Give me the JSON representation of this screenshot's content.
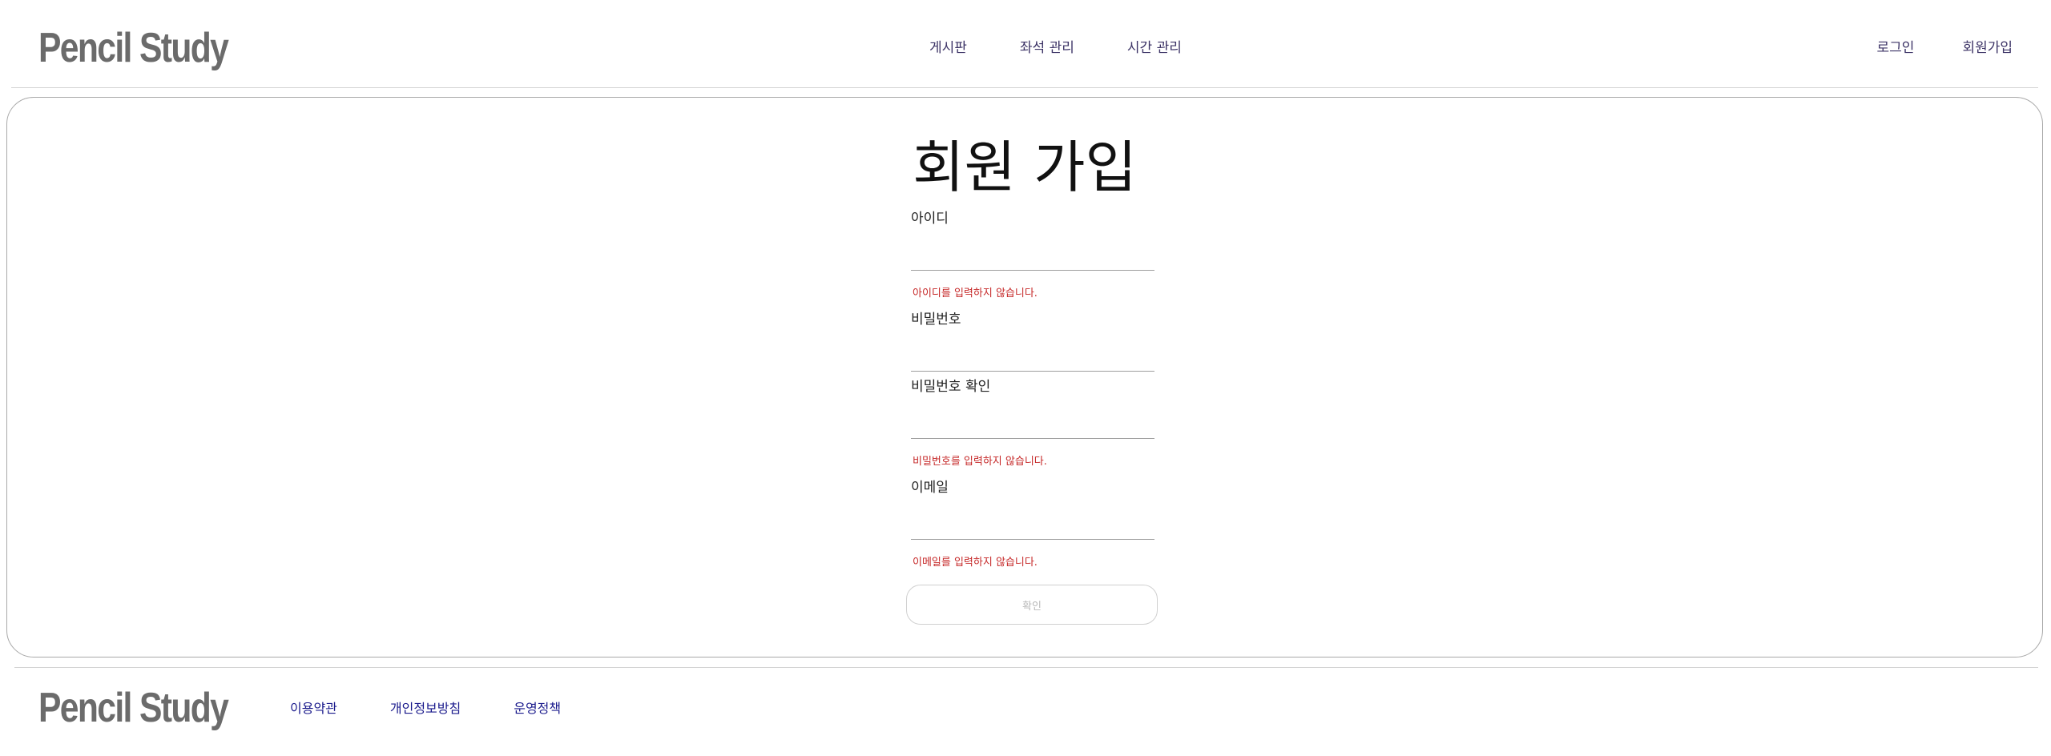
{
  "header": {
    "logo": "Pencil Study",
    "nav": [
      {
        "label": "게시판"
      },
      {
        "label": "좌석 관리"
      },
      {
        "label": "시간 관리"
      }
    ],
    "auth": {
      "login": "로그인",
      "signup": "회원가입"
    }
  },
  "signup_form": {
    "title": "회원 가입",
    "fields": {
      "username": {
        "label": "아이디",
        "value": "",
        "error": "아이디를 입력하지 않습니다."
      },
      "password": {
        "label": "비밀번호",
        "value": ""
      },
      "password_confirm": {
        "label": "비밀번호 확인",
        "value": "",
        "error": "비밀번호를 입력하지 않습니다."
      },
      "email": {
        "label": "이메일",
        "value": "",
        "error": "이메일를 입력하지 않습니다."
      }
    },
    "submit_label": "확인"
  },
  "footer": {
    "logo": "Pencil Study",
    "links": [
      {
        "label": "이용약관"
      },
      {
        "label": "개인정보방침"
      },
      {
        "label": "운영정책"
      }
    ]
  },
  "colors": {
    "logo": "#6b6b6b",
    "nav_text": "#3c3366",
    "error": "#c62828",
    "footer_link": "#1a1a8c",
    "border": "#a9a9a9"
  }
}
